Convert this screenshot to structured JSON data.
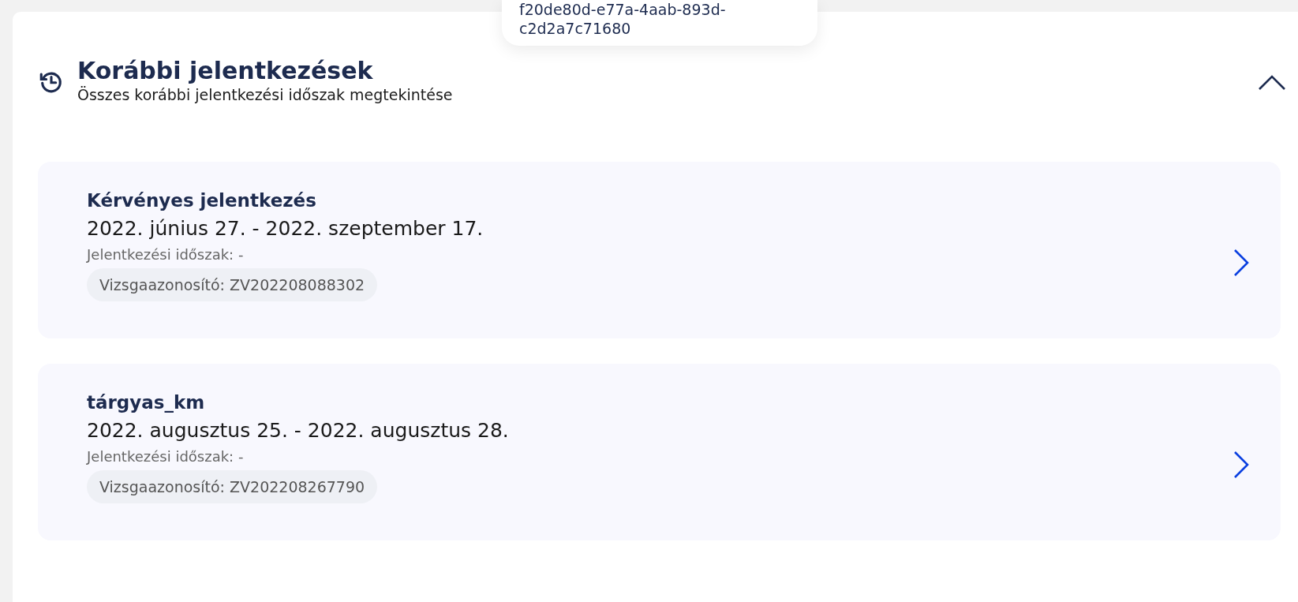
{
  "tooltip": {
    "lines": [
      "f20de80d-e77a-4aab-893d-",
      "c2d2a7c71680"
    ]
  },
  "section": {
    "title": "Korábbi jelentkezések",
    "subtitle": "Összes korábbi jelentkezési időszak megtekintése",
    "expanded": true
  },
  "registrations": [
    {
      "title": "Kérvényes jelentkezés",
      "dates": "2022. június 27. - 2022. szeptember 17.",
      "period": "Jelentkezési időszak: -",
      "exam_id": "Vizsgaazonosító: ZV202208088302"
    },
    {
      "title": "tárgyas_km",
      "dates": "2022. augusztus 25. - 2022. augusztus 28.",
      "period": "Jelentkezési időszak: -",
      "exam_id": "Vizsgaazonosító: ZV202208267790"
    }
  ]
}
